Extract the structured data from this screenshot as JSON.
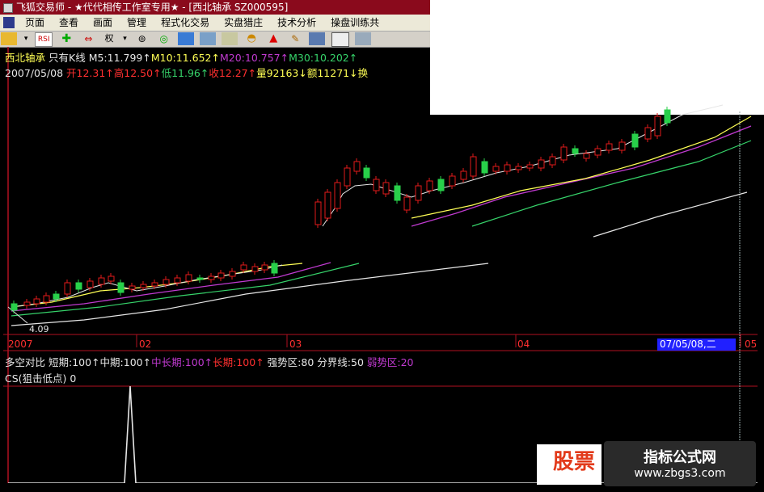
{
  "window": {
    "title": "飞狐交易师 - ★代代相传工作室专用★ - [西北轴承 SZ000595]"
  },
  "menu": [
    "页面",
    "查看",
    "画面",
    "管理",
    "程式化交易",
    "实盘猎庄",
    "技术分析",
    "操盘训练共"
  ],
  "toolbar": {
    "quan_label": "权"
  },
  "chart": {
    "stock_name": "西北轴承",
    "mode": "只有K线",
    "ma5": "M5:11.799↑",
    "ma10": "M10:11.652↑",
    "ma20": "M20:10.757↑",
    "ma30": "M30:10.202↑",
    "date": "2007/05/08",
    "open": "开12.31↑",
    "high": "高12.50↑",
    "low": "低11.96↑",
    "close": "收12.27↑",
    "volume": "量92163↓",
    "amount": "额11271↓",
    "turnover": "换",
    "low_marker": "4.09",
    "x_ticks": [
      "2007",
      "02",
      "03",
      "04",
      "05"
    ],
    "cursor_date": "07/05/08,二"
  },
  "indicator": {
    "name": "多空对比",
    "short": "短期:100↑",
    "mid": "中期:100↑",
    "midlong": "中长期:100↑",
    "long": "长期:100↑",
    "strong": "强势区:80",
    "boundary": "分界线:50",
    "weak": "弱势区:20"
  },
  "cs": {
    "name": "CS(狙击低点)",
    "value": "0"
  },
  "watermark": {
    "left_text": "股票",
    "title": "指标公式网",
    "url": "www.zbgs3.com"
  },
  "colors": {
    "up_candle": "#e21a1a",
    "down_candle": "#28d04a",
    "ma5": "#e6e6e6",
    "ma10": "#ffff55",
    "ma20": "#c03ad0",
    "ma30": "#36d36a",
    "frame": "#b01020"
  }
}
